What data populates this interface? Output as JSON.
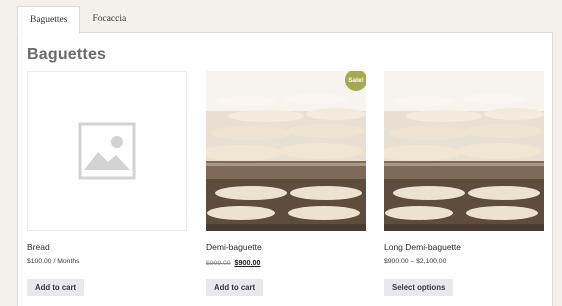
{
  "tabs": [
    {
      "label": "Baguettes",
      "active": true
    },
    {
      "label": "Focaccia",
      "active": false
    }
  ],
  "panel": {
    "title": "Baguettes"
  },
  "products": [
    {
      "name": "Bread",
      "image": "placeholder-image-icon",
      "price": "$100.00 / Months",
      "button": "Add to cart"
    },
    {
      "name": "Demi-baguette",
      "image": "baguettes-on-rack-photo",
      "sale_badge": "Sale!",
      "old_price": "$999.00",
      "price": "$900.00",
      "button": "Add to cart"
    },
    {
      "name": "Long Demi-baguette",
      "image": "baguettes-on-rack-photo",
      "price": "$900.00 – $2,100.00",
      "button": "Select options"
    }
  ],
  "colors": {
    "page_background": "#f4f1ec",
    "sale_badge": "#a6a94f",
    "button_background": "#e9e8ef"
  }
}
